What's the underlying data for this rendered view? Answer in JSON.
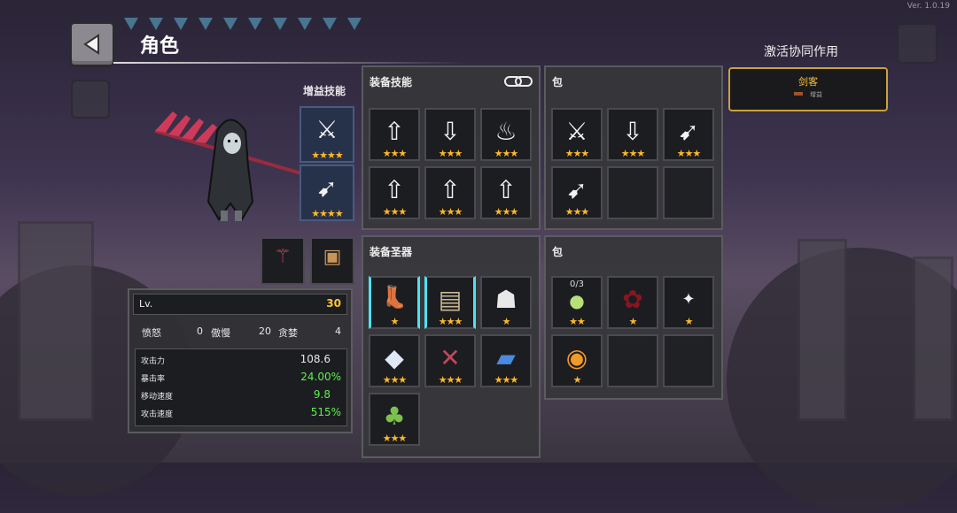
{
  "version": "Ver. 1.0.19",
  "header": {
    "title": "角色"
  },
  "buff_skills": {
    "label": "增益技能",
    "slots": [
      {
        "icon": "sword-wing-icon",
        "stars": "★★★★",
        "glyph": "⚔"
      },
      {
        "icon": "arrow-boot-icon",
        "stars": "★★★★",
        "glyph": "➹"
      }
    ]
  },
  "equipment_slots": [
    {
      "icon": "scythe-icon",
      "glyph": "⚚"
    },
    {
      "icon": "chest-icon",
      "glyph": "▣"
    }
  ],
  "stats": {
    "level_label": "Lv.",
    "level_value": "30",
    "anger_label": "愤怒",
    "anger_value": "0",
    "pride_label": "傲慢",
    "pride_value": "20",
    "greed_label": "贪婪",
    "greed_value": "4",
    "attack_label": "攻击力",
    "attack_value": "108.6",
    "crit_label": "暴击率",
    "crit_value": "24.00%",
    "move_label": "移动速度",
    "move_value": "9.8",
    "atkspd_label": "攻击速度",
    "atkspd_value": "515%"
  },
  "equipped_skills": {
    "title": "装备技能",
    "link_icon": "chain-link-icon",
    "slots": [
      {
        "icon": "arrow-up-icon",
        "glyph": "⇧",
        "stars": "★★★"
      },
      {
        "icon": "arrow-down-icon",
        "glyph": "⇩",
        "stars": "★★★"
      },
      {
        "icon": "dish-icon",
        "glyph": "♨",
        "stars": "★★★"
      },
      {
        "icon": "arrow-up-icon",
        "glyph": "⇧",
        "stars": "★★★"
      },
      {
        "icon": "arrow-up-icon",
        "glyph": "⇧",
        "stars": "★★★"
      },
      {
        "icon": "arrow-up-icon",
        "glyph": "⇧",
        "stars": "★★★"
      }
    ]
  },
  "skill_bag": {
    "title": "包",
    "slots": [
      {
        "icon": "sword-wing-icon",
        "glyph": "⚔",
        "stars": "★★★"
      },
      {
        "icon": "arrow-down-icon",
        "glyph": "⇩",
        "stars": "★★★"
      },
      {
        "icon": "arrow-boot-icon",
        "glyph": "➹",
        "stars": "★★★"
      },
      {
        "icon": "arrow-boot-icon",
        "glyph": "➹",
        "stars": "★★★"
      }
    ]
  },
  "equipped_relics": {
    "title": "装备圣器",
    "slots": [
      {
        "icon": "boot-icon",
        "glyph": "👢",
        "stars": "★"
      },
      {
        "icon": "scroll-icon",
        "glyph": "▤",
        "stars": "★★★"
      },
      {
        "icon": "fox-mask-icon",
        "glyph": "☗",
        "stars": "★"
      },
      {
        "icon": "crystal-icon",
        "glyph": "◆",
        "stars": "★★★"
      },
      {
        "icon": "crossbow-icon",
        "glyph": "✕",
        "stars": "★★★"
      },
      {
        "icon": "book-icon",
        "glyph": "▰",
        "stars": "★★★"
      },
      {
        "icon": "green-cloak-icon",
        "glyph": "♣",
        "stars": "★★★"
      }
    ]
  },
  "relic_bag": {
    "title": "包",
    "slots": [
      {
        "icon": "eggs-nest-icon",
        "glyph": "●",
        "stars": "★★",
        "count": "0/3"
      },
      {
        "icon": "blood-drop-icon",
        "glyph": "✿",
        "stars": "★"
      },
      {
        "icon": "sparkle-icon",
        "glyph": "✦",
        "stars": "★"
      },
      {
        "icon": "orange-orb-icon",
        "glyph": "◉",
        "stars": "★"
      }
    ]
  },
  "synergy": {
    "title": "激活协同作用",
    "card_name": "剑客",
    "card_sub": "增益"
  }
}
